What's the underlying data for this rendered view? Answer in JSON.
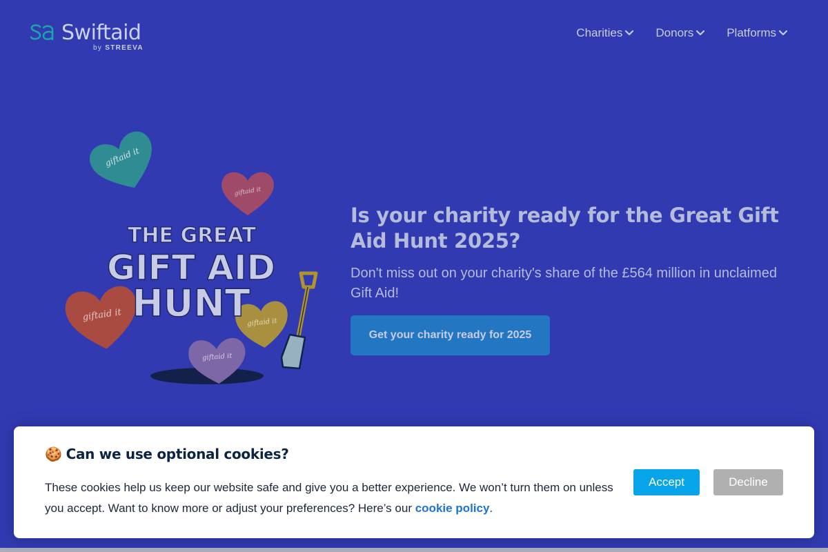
{
  "header": {
    "logo_mark": "sa",
    "logo_word": "Swiftaid",
    "logo_by": "by",
    "logo_company": "STREEVA",
    "nav": [
      {
        "label": "Charities",
        "icon": "chevron-down-icon"
      },
      {
        "label": "Donors",
        "icon": "chevron-down-icon"
      },
      {
        "label": "Platforms",
        "icon": "chevron-down-icon"
      }
    ]
  },
  "hero": {
    "art": {
      "line1": "THE GREAT",
      "line2": "GIFT AID",
      "line3": "HUNT",
      "heart_text": "giftaid it",
      "icons": [
        "heart-icon",
        "shovel-icon"
      ]
    },
    "title": "Is your charity ready for the Great Gift Aid Hunt 2025?",
    "subtitle": "Don't miss out on your charity's share of the £564 million in unclaimed Gift Aid!",
    "cta_label": "Get your charity ready for 2025"
  },
  "cookie_banner": {
    "emoji": "🍪",
    "title": "Can we use optional cookies?",
    "text_before": "These cookies help us keep our website safe and give you a better experience. We won’t turn them on unless you accept. Want to know more or adjust your preferences? Here’s our ",
    "link_label": "cookie policy",
    "text_after": ".",
    "accept_label": "Accept",
    "decline_label": "Decline"
  },
  "colors": {
    "page_background": "#323ab2",
    "cta_background": "#2276c2",
    "accept_button": "#08a4ea",
    "decline_button": "#b0b0b0",
    "link": "#1a74d6"
  }
}
